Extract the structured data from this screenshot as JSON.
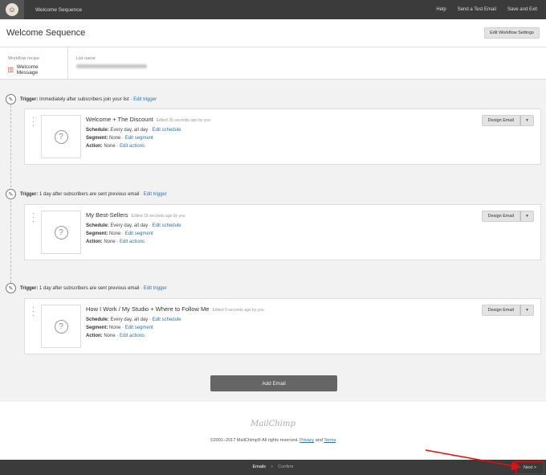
{
  "topbar": {
    "logo_icon": "mailchimp-chimp-icon",
    "title": "Welcome Sequence",
    "links": [
      "Help",
      "Send a Test Email",
      "Save and Exit"
    ]
  },
  "header": {
    "title": "Welcome Sequence",
    "settings_button": "Edit Workflow Settings"
  },
  "recipe": {
    "recipe_label": "Workflow recipe",
    "recipe_value": "Welcome Message",
    "list_label": "List name"
  },
  "triggers": [
    {
      "label": "Trigger:",
      "text": "Immediately after subscribers join your list ·",
      "link": "Edit trigger"
    },
    {
      "label": "Trigger:",
      "text": "1 day after subscribers are sent previous email ·",
      "link": "Edit trigger"
    },
    {
      "label": "Trigger:",
      "text": "1 day after subscribers are sent previous email ·",
      "link": "Edit trigger"
    }
  ],
  "emails": [
    {
      "title": "Welcome + The Discount",
      "edited": "Edited 35 seconds ago by you",
      "schedule_label": "Schedule:",
      "schedule_value": "Every day, all day ·",
      "schedule_link": "Edit schedule",
      "segment_label": "Segment:",
      "segment_value": "None ·",
      "segment_link": "Edit segment",
      "action_label": "Action:",
      "action_value": "None ·",
      "action_link": "Edit actions",
      "design_button": "Design Email"
    },
    {
      "title": "My Best-Sellers",
      "edited": "Edited 18 seconds ago by you",
      "schedule_label": "Schedule:",
      "schedule_value": "Every day, all day ·",
      "schedule_link": "Edit schedule",
      "segment_label": "Segment:",
      "segment_value": "None ·",
      "segment_link": "Edit segment",
      "action_label": "Action:",
      "action_value": "None ·",
      "action_link": "Edit actions",
      "design_button": "Design Email"
    },
    {
      "title": "How I Work / My Studio + Where to Follow Me",
      "edited": "Edited 0 seconds ago by you",
      "schedule_label": "Schedule:",
      "schedule_value": "Every day, all day ·",
      "schedule_link": "Edit schedule",
      "segment_label": "Segment:",
      "segment_value": "None ·",
      "segment_link": "Edit segment",
      "action_label": "Action:",
      "action_value": "None ·",
      "action_link": "Edit actions",
      "design_button": "Design Email"
    }
  ],
  "add_email_button": "Add Email",
  "footer": {
    "logo_text": "MailChimp",
    "copyright": "©2001–2017 MailChimp® All rights reserved.",
    "privacy_link": "Privacy",
    "and": "and",
    "terms_link": "Terms"
  },
  "bottombar": {
    "step_active": "Emails",
    "step_separator": ">",
    "step_next": "Confirm",
    "next_button": "Next >"
  },
  "colors": {
    "topbar_bg": "#3b3b3b",
    "link": "#2f74a8",
    "annotation": "#e01010"
  }
}
